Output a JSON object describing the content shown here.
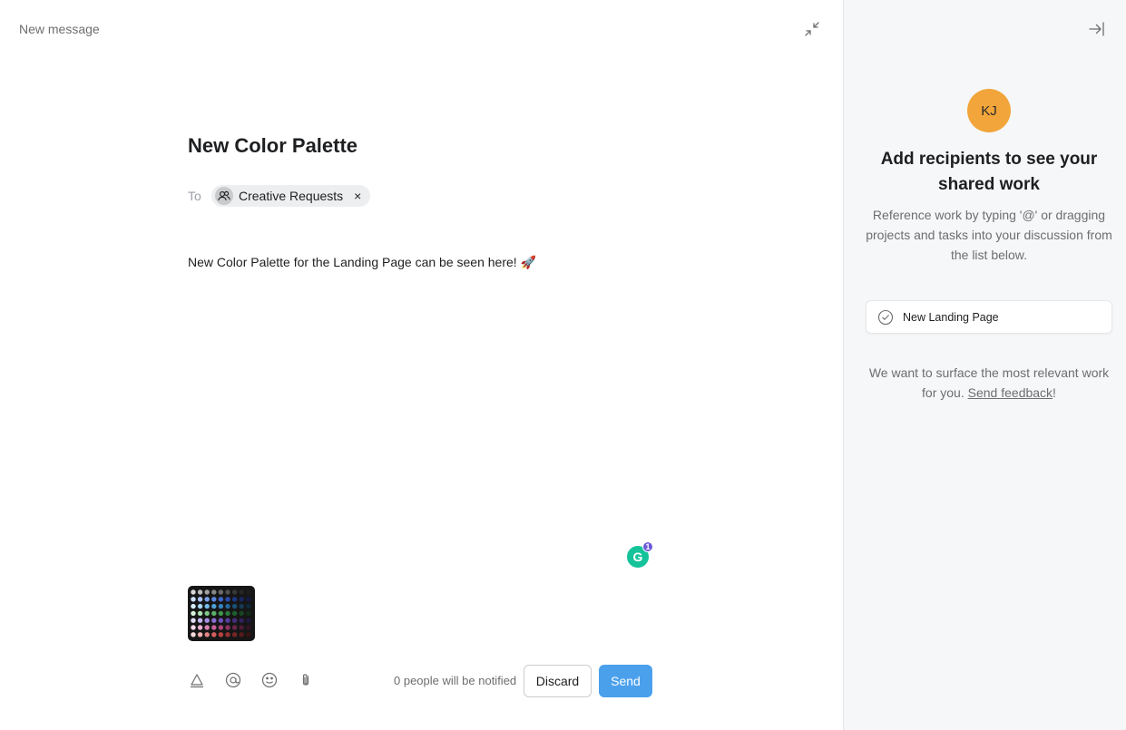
{
  "compose": {
    "window_title": "New message",
    "subject": "New Color Palette",
    "to_label": "To",
    "recipient": "Creative Requests",
    "recipient_remove": "×",
    "body": "New Color Palette for the Landing Page can be seen here! 🚀",
    "grammarly_glyph": "G",
    "grammarly_count": "1",
    "notify_text": "0 people will be notified",
    "discard_label": "Discard",
    "send_label": "Send",
    "toolbar_icons": [
      "text-format-icon",
      "mention-icon",
      "emoji-icon",
      "attachment-icon"
    ]
  },
  "sidebar": {
    "avatar_initials": "KJ",
    "avatar_color": "#f1a53a",
    "heading": "Add recipients to see your shared work",
    "description": "Reference work by typing '@' or dragging projects and tasks into your discussion from the list below.",
    "work_item": "New Landing Page",
    "footer_prefix": "We want to surface the most relevant work for you. ",
    "footer_link": "Send feedback",
    "footer_suffix": "!"
  },
  "colors": {
    "send_button": "#4ba0ec",
    "sidebar_bg": "#f6f7f8",
    "grammarly": "#15c39a"
  }
}
